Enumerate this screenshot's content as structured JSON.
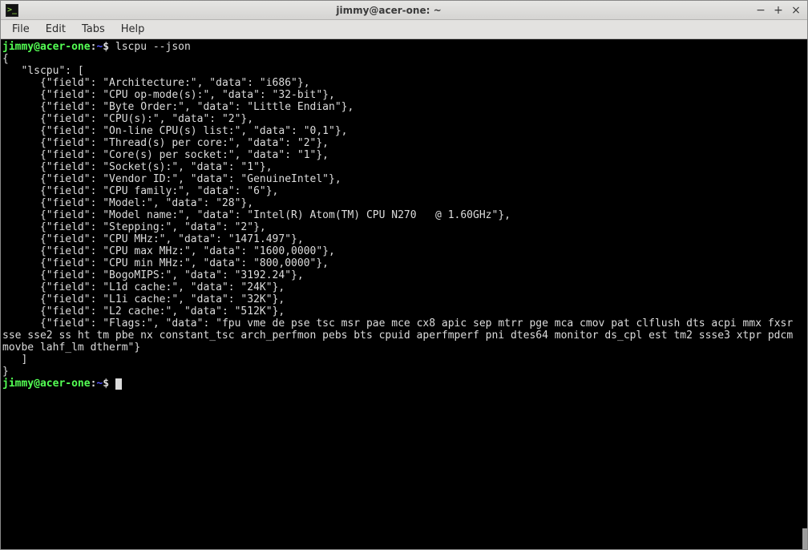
{
  "window": {
    "title": "jimmy@acer-one: ~"
  },
  "menubar": {
    "items": [
      "File",
      "Edit",
      "Tabs",
      "Help"
    ]
  },
  "terminal": {
    "prompt_user": "jimmy@acer-one",
    "prompt_path": "~",
    "prompt_symbol": "$",
    "command": "lscpu --json",
    "output_open": "{",
    "output_key": "   \"lscpu\": [",
    "entries": [
      "      {\"field\": \"Architecture:\", \"data\": \"i686\"},",
      "      {\"field\": \"CPU op-mode(s):\", \"data\": \"32-bit\"},",
      "      {\"field\": \"Byte Order:\", \"data\": \"Little Endian\"},",
      "      {\"field\": \"CPU(s):\", \"data\": \"2\"},",
      "      {\"field\": \"On-line CPU(s) list:\", \"data\": \"0,1\"},",
      "      {\"field\": \"Thread(s) per core:\", \"data\": \"2\"},",
      "      {\"field\": \"Core(s) per socket:\", \"data\": \"1\"},",
      "      {\"field\": \"Socket(s):\", \"data\": \"1\"},",
      "      {\"field\": \"Vendor ID:\", \"data\": \"GenuineIntel\"},",
      "      {\"field\": \"CPU family:\", \"data\": \"6\"},",
      "      {\"field\": \"Model:\", \"data\": \"28\"},",
      "      {\"field\": \"Model name:\", \"data\": \"Intel(R) Atom(TM) CPU N270   @ 1.60GHz\"},",
      "      {\"field\": \"Stepping:\", \"data\": \"2\"},",
      "      {\"field\": \"CPU MHz:\", \"data\": \"1471.497\"},",
      "      {\"field\": \"CPU max MHz:\", \"data\": \"1600,0000\"},",
      "      {\"field\": \"CPU min MHz:\", \"data\": \"800,0000\"},",
      "      {\"field\": \"BogoMIPS:\", \"data\": \"3192.24\"},",
      "      {\"field\": \"L1d cache:\", \"data\": \"24K\"},",
      "      {\"field\": \"L1i cache:\", \"data\": \"32K\"},",
      "      {\"field\": \"L2 cache:\", \"data\": \"512K\"},"
    ],
    "flags_line": "      {\"field\": \"Flags:\", \"data\": \"fpu vme de pse tsc msr pae mce cx8 apic sep mtrr pge mca cmov pat clflush dts acpi mmx fxsr sse sse2 ss ht tm pbe nx constant_tsc arch_perfmon pebs bts cpuid aperfmperf pni dtes64 monitor ds_cpl est tm2 ssse3 xtpr pdcm movbe lahf_lm dtherm\"}",
    "output_close_arr": "   ]",
    "output_close": "}"
  }
}
